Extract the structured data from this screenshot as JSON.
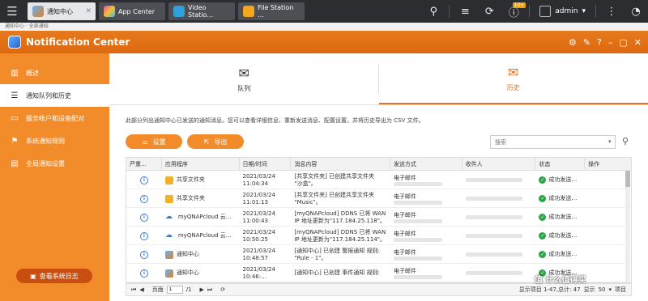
{
  "topbar": {
    "tabs": [
      {
        "label": "通知中心",
        "active": true
      },
      {
        "label": "App Center",
        "active": false
      },
      {
        "label": "Video Statio…",
        "active": false
      },
      {
        "label": "File Station …",
        "active": false
      }
    ],
    "badge": "10+",
    "user": "admin"
  },
  "breadcrumb": "通知中心 · 全部通知",
  "app": {
    "title": "Notification Center"
  },
  "sidebar": {
    "items": [
      {
        "label": "概述",
        "icon": "chart-icon"
      },
      {
        "label": "通知队列和历史",
        "icon": "list-icon"
      },
      {
        "label": "服务帐户和设备配对",
        "icon": "device-icon"
      },
      {
        "label": "系统通知规则",
        "icon": "rule-icon"
      },
      {
        "label": "全局通知设置",
        "icon": "settings-icon"
      }
    ],
    "log_button": "查看系统日志"
  },
  "main": {
    "tabs": [
      {
        "label": "队列"
      },
      {
        "label": "历史"
      }
    ],
    "description": "此部分列出通知中心已发送的通知消息。您可以查看详细信息、重新发送消息、配置设置，并将历史导出为 CSV 文件。",
    "settings_button": "设置",
    "export_button": "导出",
    "search_placeholder": "搜索",
    "columns": [
      "严重…",
      "应用程序",
      "日期/时间",
      "消息内容",
      "发送方式",
      "收件人",
      "状态",
      "操作"
    ],
    "rows": [
      {
        "app": "共享文件夹",
        "appicon": "folder",
        "date": "2021/03/24",
        "time": "11:04:34",
        "msg1": "[共享文件夹] 已创建共享文件夹",
        "msg2": "\"沙盒\"。",
        "method": "电子邮件",
        "status": "成功发送…"
      },
      {
        "app": "共享文件夹",
        "appicon": "folder",
        "date": "2021/03/24",
        "time": "11:01:13",
        "msg1": "[共享文件夹] 已创建共享文件夹",
        "msg2": "\"Music\"。",
        "method": "电子邮件",
        "status": "成功发送…"
      },
      {
        "app": "myQNAPcloud 云…",
        "appicon": "cloud",
        "date": "2021/03/24",
        "time": "11:00:43",
        "msg1": "[myQNAPcloud] DDNS 已将 WAN",
        "msg2": "IP 地址更新为\"117.184.25.118\"。",
        "method": "电子邮件",
        "status": "成功发送…"
      },
      {
        "app": "myQNAPcloud 云…",
        "appicon": "cloud",
        "date": "2021/03/24",
        "time": "10:50:25",
        "msg1": "[myQNAPcloud] DDNS 已将 WAN",
        "msg2": "IP 地址更新为\"117.184.25.114\"。",
        "method": "电子邮件",
        "status": "成功发送…"
      },
      {
        "app": "通知中心",
        "appicon": "nc",
        "date": "2021/03/24",
        "time": "10:48:57",
        "msg1": "[通知中心] 已创建 警报通知 规则:",
        "msg2": "\"Rule - 1\"。",
        "method": "电子邮件",
        "status": "成功发送…"
      },
      {
        "app": "通知中心",
        "appicon": "nc",
        "date": "2021/03/24",
        "time": "10:46:…",
        "msg1": "[通知中心] 已创建 事件通知 规则:",
        "msg2": "",
        "method": "电子邮件",
        "status": "成功发送…"
      }
    ],
    "pager": {
      "page_label": "页面",
      "page": "1",
      "total": "/1",
      "display": "显示项目 1-47,总计: 47",
      "per_page_label": "显示",
      "per_page": "50",
      "items_label": "项目"
    }
  },
  "watermark": "值 什么值得买"
}
